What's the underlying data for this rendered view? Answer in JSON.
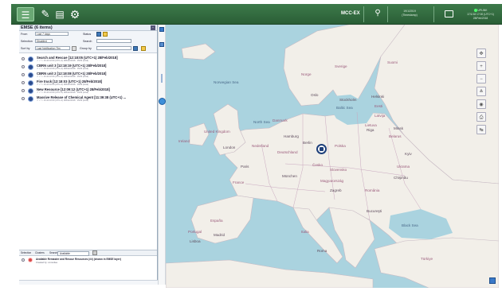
{
  "topbar": {
    "node": "MCC-EX",
    "date_line1": "19/1/2019",
    "date_line2": "(Timestamp)",
    "status_line1": "UPLINK",
    "status_line2": "17/1/18 17:00 (UTC+1) 28/Feb/2018",
    "icons": [
      "menu-icon",
      "pen-icon",
      "chart-icon",
      "gear-icon",
      "search-icon",
      "card-icon",
      "info-icon",
      "panel-icon"
    ]
  },
  "panel": {
    "title": "EMSE (6 items)",
    "filters": {
      "from_label": "From",
      "from_value": "Last 7 days",
      "status_label": "Status",
      "selection_label": "Selection",
      "selection_value": "Disabled",
      "search_label": "Search",
      "sort_label": "Sort by",
      "sort_value": "Last Notification Tim",
      "group_label": "Group by"
    },
    "events": [
      {
        "title": "Search and Rescue [12:18:05 (UTC+1) 28/Feb/2018]",
        "sub": "↗ ↗ ↖ 16.42 22:09 (UTC+1) 28/Feb/2018 · 15/03 (local)"
      },
      {
        "title": "CBRN unit 3 [12:18:19 (UTC+1) 28/Feb/2018]",
        "sub": "↗ ↗ ↖ 16.42 22:09 (UTC+1) 28/Feb/2018 · 15/03 (local)"
      },
      {
        "title": "CBRN unit 2 [12:18:08 (UTC+1) 28/Feb/2018]",
        "sub": "↗ ↗ ↖ 16.42 22:09 (UTC+1) 28/Feb/2018 · 15/03 (local)"
      },
      {
        "title": "Fire truck [12:18:03 (UTC+1) 28/Feb/2018]",
        "sub": "↗ ↗ ↖ 16.42 22:09 (UTC+1) 28/Feb/2018 · 15/03 (local)"
      },
      {
        "title": "New Resource [12:09:12 (UTC+1) 28/Feb/2018]",
        "sub": "↗ ↗ ↖ 16.42 22:09 (UTC+1) 28/Feb/2018 · 15/03 (local)"
      },
      {
        "title": "Massive Release of Chemical Agent [11:39:38 (UTC+1) ...",
        "sub": "↗ ↗ ↖ 16.42 22:09 (UTC+1) 28/Feb/2018 · 15/03 (local)"
      }
    ],
    "bottom_tabs": [
      "Selection",
      "Clusters",
      "Search",
      "Available"
    ],
    "bottom_items": [
      {
        "title": "Available Remaster and Rescue Resources (##) (shown in EMSE layer)",
        "sub": "Created by: consultee"
      }
    ]
  },
  "map": {
    "seas": [
      {
        "label": "Norwegian Sea"
      },
      {
        "label": "North Sea"
      },
      {
        "label": "Baltic Sea"
      },
      {
        "label": "Black Sea"
      }
    ],
    "countries": [
      "Norge",
      "Sverige",
      "Suomi",
      "Eesti",
      "Latvija",
      "Lietuva",
      "Danmark",
      "United Kingdom",
      "Ireland",
      "Nederland",
      "Deutschland",
      "Polska",
      "Česko",
      "Slovensko",
      "France",
      "Magyarország",
      "România",
      "Ukraïna",
      "Belarus",
      "Italia",
      "España",
      "Portugal",
      "Türkiye",
      "Chişinău"
    ],
    "cities": [
      "Oslo",
      "Stockholm",
      "Helsinki",
      "Riga",
      "Hamburg",
      "Berlin",
      "London",
      "Paris",
      "München",
      "Zagreb",
      "Kyiv",
      "Minsk",
      "Roma",
      "Madrid",
      "Lisboa",
      "Bucureşti"
    ],
    "zoom_plus": "+",
    "zoom_minus": "−"
  }
}
